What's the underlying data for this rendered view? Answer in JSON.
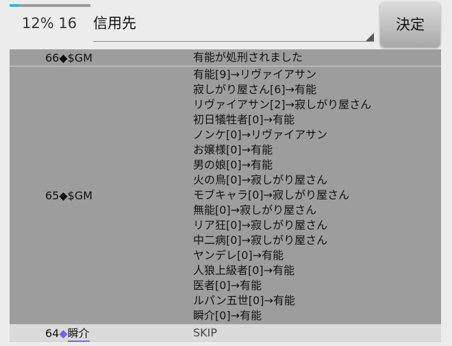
{
  "progress": {
    "fraction": 0.12
  },
  "header": {
    "counter_text": "12% 16",
    "target_value": "信用先",
    "decide_label": "決定"
  },
  "log": [
    {
      "day": "66",
      "sep": "◆",
      "name": "$GM",
      "lines": [
        "有能が処刑されました"
      ]
    },
    {
      "day": "65",
      "sep": "◆",
      "name": "$GM",
      "lines": [
        "有能[9]→リヴァイアサン",
        "寂しがり屋さん[6]→有能",
        "リヴァイアサン[2]→寂しがり屋さん",
        "初日犠牲者[0]→有能",
        "ノンケ[0]→リヴァイアサン",
        "お嬢様[0]→有能",
        "男の娘[0]→有能",
        "火の鳥[0]→寂しがり屋さん",
        "モブキャラ[0]→寂しがり屋さん",
        "無能[0]→寂しがり屋さん",
        "リア狂[0]→寂しがり屋さん",
        "中二病[0]→寂しがり屋さん",
        "ヤンデレ[0]→有能",
        "人狼上級者[0]→有能",
        "医者[0]→有能",
        "ルパン五世[0]→有能",
        "瞬介[0]→有能"
      ]
    },
    {
      "day": "64",
      "sep": "◆",
      "name": "瞬介",
      "lines": [
        "SKIP"
      ]
    }
  ],
  "colors": {
    "accent": "#33b5e5",
    "row_dark": "#9d9d9d",
    "row_light": "#dadada",
    "user_diamond": "#7a5ef0"
  }
}
